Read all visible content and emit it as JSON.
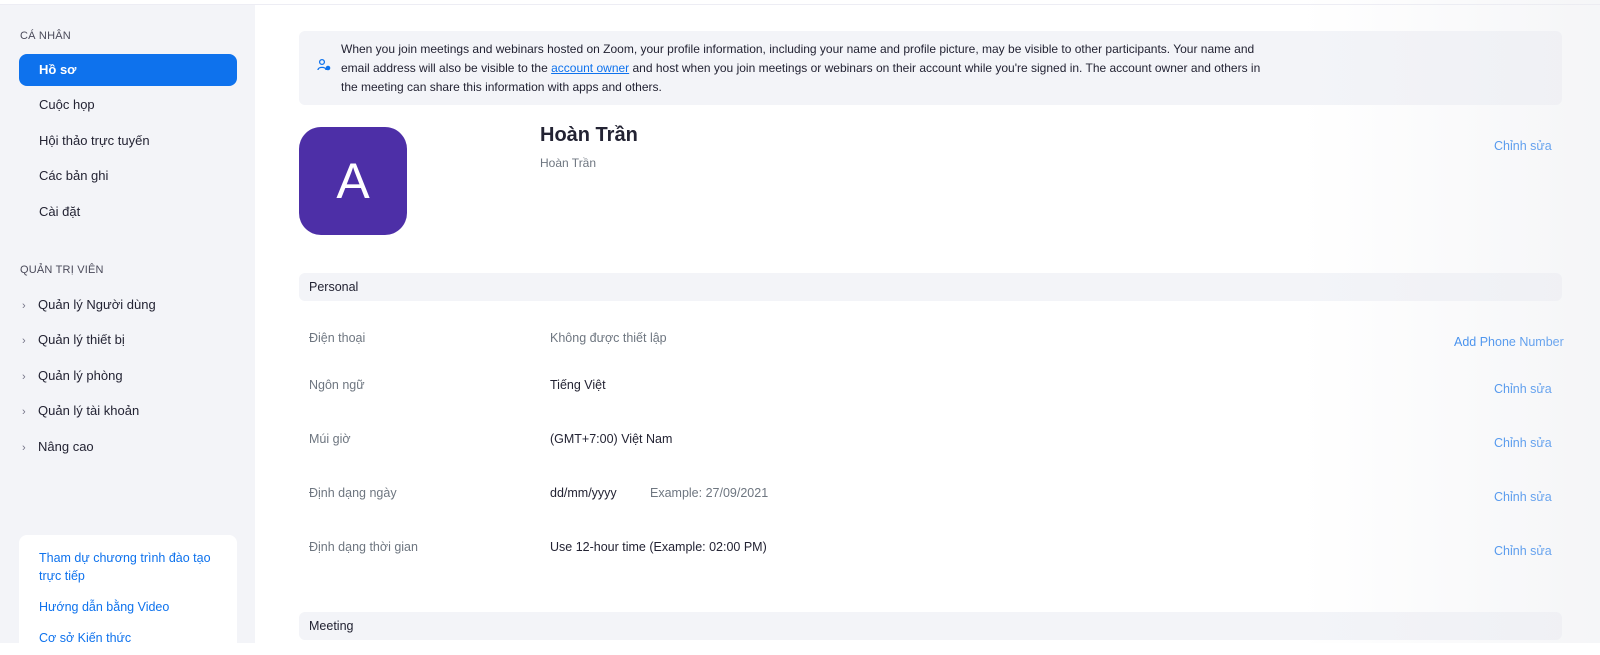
{
  "sidebar": {
    "personal_label": "CÁ NHÂN",
    "personal_items": [
      {
        "label": "Hồ sơ",
        "active": true
      },
      {
        "label": "Cuộc họp",
        "active": false
      },
      {
        "label": "Hội thảo trực tuyến",
        "active": false
      },
      {
        "label": "Các bản ghi",
        "active": false
      },
      {
        "label": "Cài đặt",
        "active": false
      }
    ],
    "admin_label": "QUẢN TRỊ VIÊN",
    "admin_items": [
      {
        "label": "Quản lý Người dùng"
      },
      {
        "label": "Quản lý thiết bị"
      },
      {
        "label": "Quản lý phòng"
      },
      {
        "label": "Quản lý tài khoản"
      },
      {
        "label": "Nâng cao"
      }
    ],
    "help_links": [
      {
        "label": "Tham dự chương trình đào tạo trực tiếp"
      },
      {
        "label": "Hướng dẫn bằng Video"
      },
      {
        "label": "Cơ sở Kiến thức"
      }
    ]
  },
  "notice": {
    "text_before": "When you join meetings and webinars hosted on Zoom, your profile information, including your name and profile picture, may be visible to other participants. Your name and email address will also be visible to the ",
    "link": "account owner",
    "text_after": " and host when you join meetings or webinars on their account while you're signed in. The account owner and others in the meeting can share this information with apps and others."
  },
  "profile": {
    "avatar_letter": "A",
    "avatar_color": "#4d2fa7",
    "name": "Hoàn Trần",
    "display_name": "Hoàn Trần",
    "edit_label": "Chỉnh sửa"
  },
  "personal_section": {
    "title": "Personal",
    "rows": [
      {
        "label": "Điện thoại",
        "value": "Không được thiết lập",
        "action": "Add Phone Number"
      },
      {
        "label": "Ngôn ngữ",
        "value": "Tiếng Việt",
        "action": "Chỉnh sửa"
      },
      {
        "label": "Múi giờ",
        "value": "(GMT+7:00) Việt Nam",
        "action": "Chỉnh sửa"
      },
      {
        "label": "Định dạng ngày",
        "value": "dd/mm/yyyy",
        "note": "Example: 27/09/2021",
        "action": "Chỉnh sửa"
      },
      {
        "label": "Định dạng thời gian",
        "value": "Use 12-hour time (Example: 02:00 PM)",
        "action": "Chỉnh sửa"
      }
    ]
  },
  "meeting_section": {
    "title": "Meeting"
  },
  "colors": {
    "accent": "#0e72ed",
    "sidebar_bg": "#f3f4f8"
  }
}
